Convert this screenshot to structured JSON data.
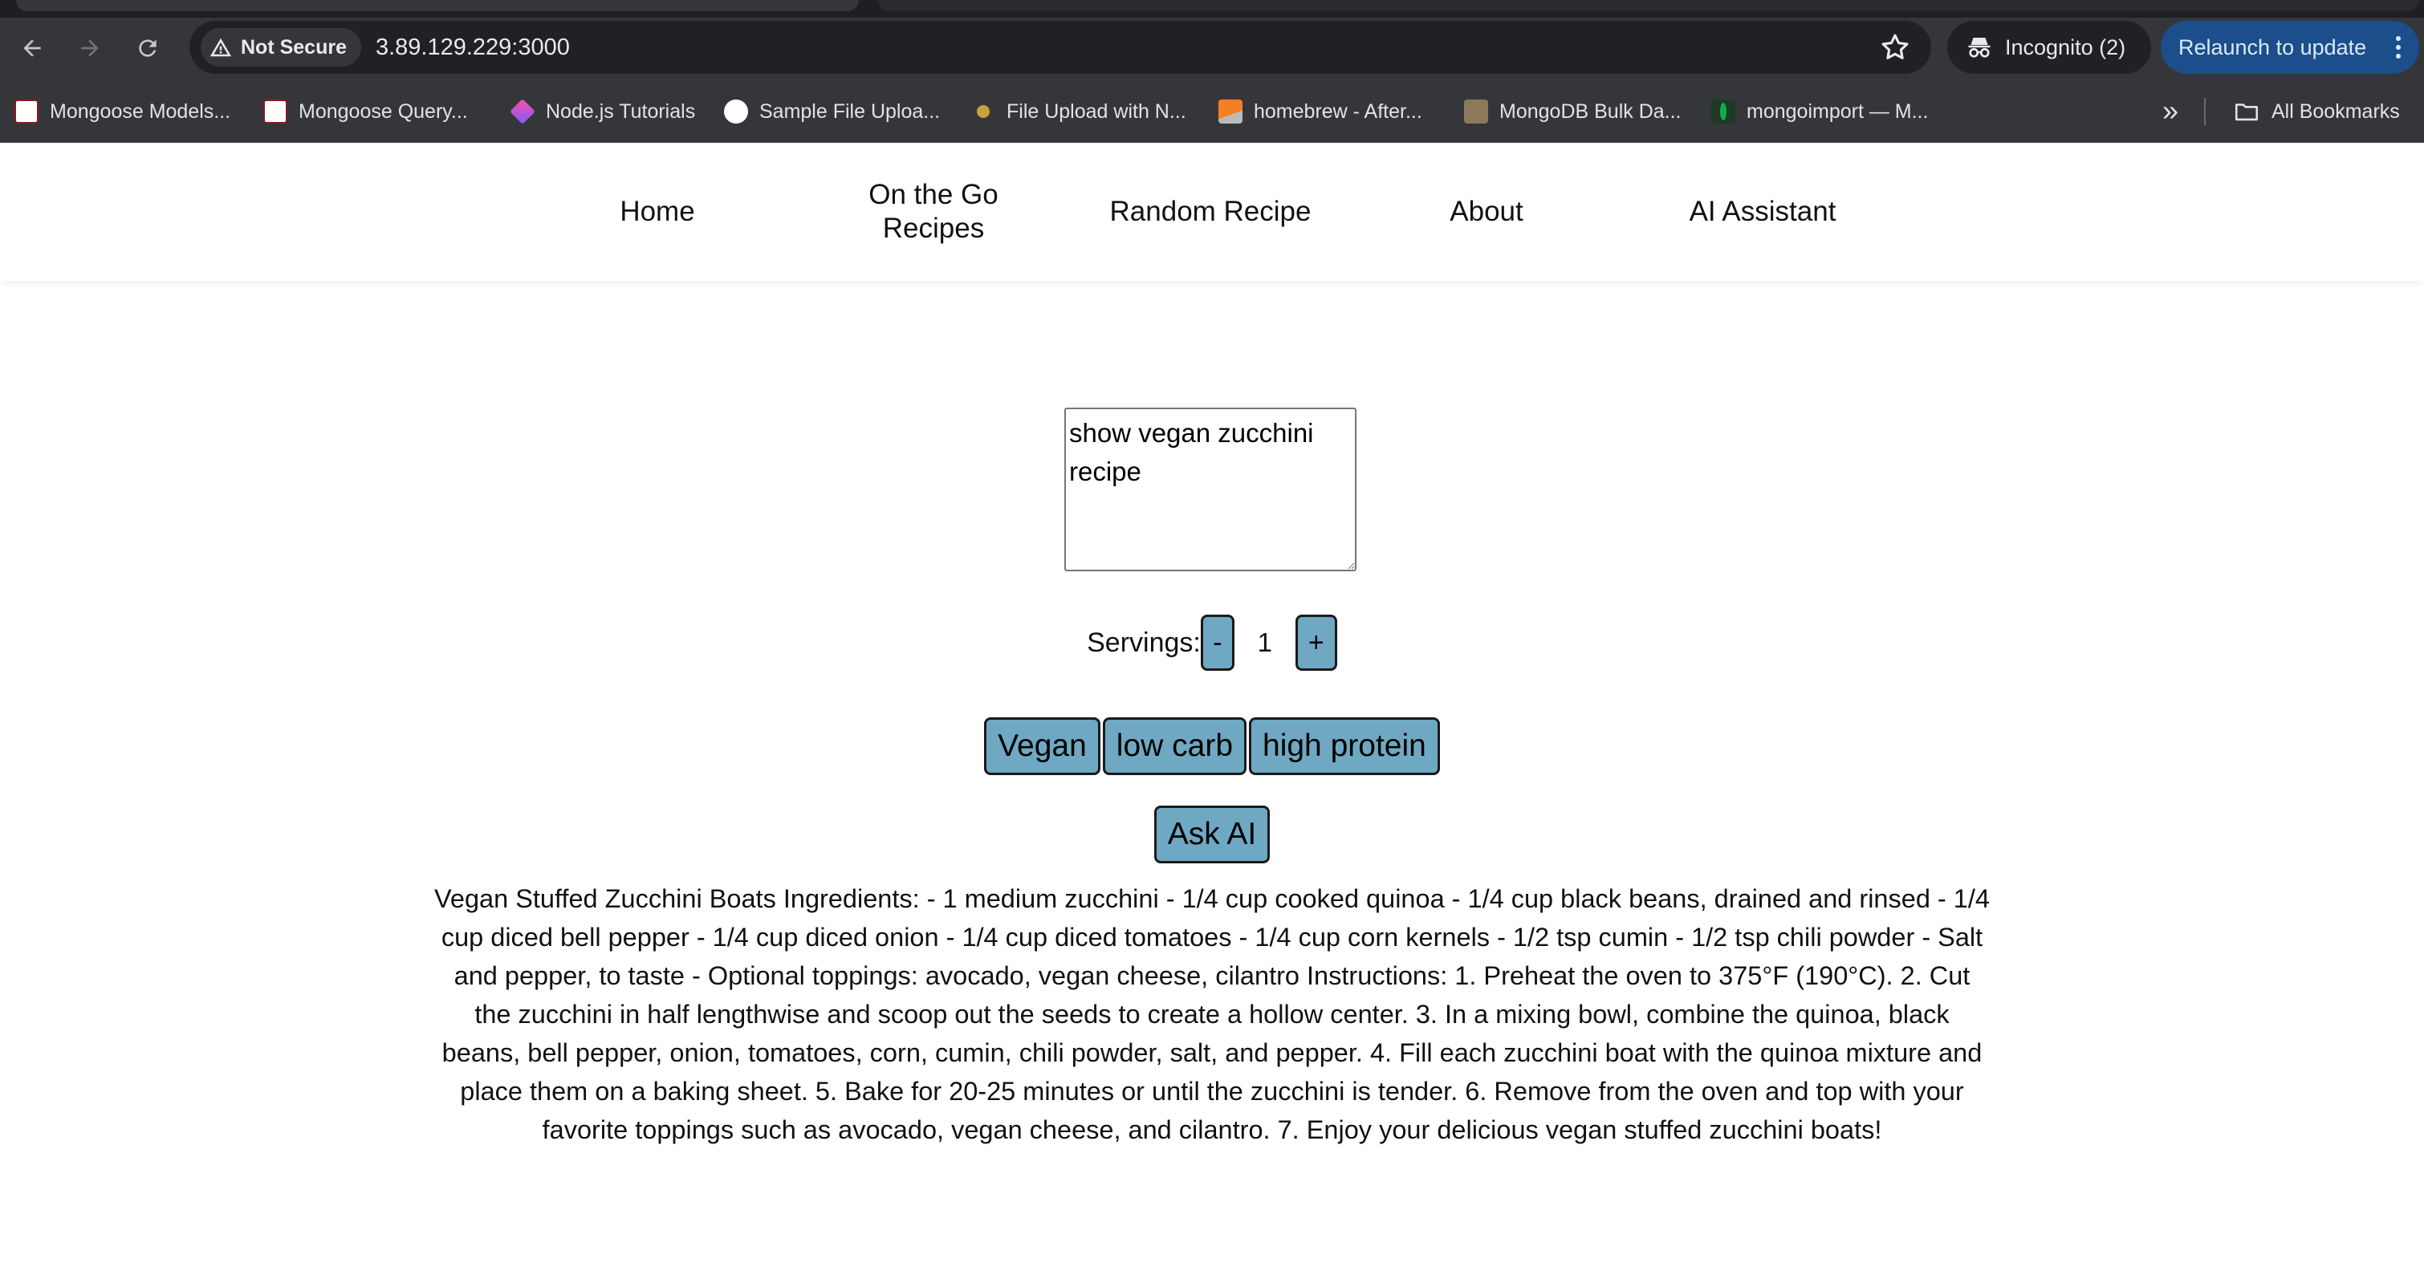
{
  "browser": {
    "security_label": "Not Secure",
    "url": "3.89.129.229:3000",
    "incognito_label": "Incognito (2)",
    "relaunch_label": "Relaunch to update",
    "bookmarks": [
      {
        "label": "Mongoose Models...",
        "icon": "mongoose-icon",
        "color": "#8b1a1a"
      },
      {
        "label": "Mongoose Query...",
        "icon": "mongoose-icon",
        "color": "#8b1a1a"
      },
      {
        "label": "Node.js Tutorials",
        "icon": "nodejs-tutorials-icon",
        "color": "#b44cf0"
      },
      {
        "label": "Sample File Uploa...",
        "icon": "github-icon",
        "color": "#ffffff"
      },
      {
        "label": "File Upload with N...",
        "icon": "sun-gear-icon",
        "color": "#c9a23a"
      },
      {
        "label": "homebrew - After...",
        "icon": "stackoverflow-icon",
        "color": "#f48024"
      },
      {
        "label": "MongoDB Bulk Da...",
        "icon": "avatar-icon",
        "color": "#8a7a5a"
      },
      {
        "label": "mongoimport — M...",
        "icon": "mongodb-leaf-icon",
        "color": "#13aa52"
      }
    ],
    "all_bookmarks_label": "All Bookmarks"
  },
  "nav": {
    "items": [
      "Home",
      "On the Go Recipes",
      "Random Recipe",
      "About",
      "AI Assistant"
    ]
  },
  "form": {
    "prompt_value": "show vegan zucchini recipe",
    "servings_label": "Servings:",
    "decrement_label": "-",
    "servings_value": "1",
    "increment_label": "+",
    "tags": [
      "Vegan",
      "low carb",
      "high protein"
    ],
    "ask_label": "Ask AI"
  },
  "answer": "Vegan Stuffed Zucchini Boats Ingredients: - 1 medium zucchini - 1/4 cup cooked quinoa - 1/4 cup black beans, drained and rinsed - 1/4 cup diced bell pepper - 1/4 cup diced onion - 1/4 cup diced tomatoes - 1/4 cup corn kernels - 1/2 tsp cumin - 1/2 tsp chili powder - Salt and pepper, to taste - Optional toppings: avocado, vegan cheese, cilantro Instructions: 1. Preheat the oven to 375°F (190°C). 2. Cut the zucchini in half lengthwise and scoop out the seeds to create a hollow center. 3. In a mixing bowl, combine the quinoa, black beans, bell pepper, onion, tomatoes, corn, cumin, chili powder, salt, and pepper. 4. Fill each zucchini boat with the quinoa mixture and place them on a baking sheet. 5. Bake for 20-25 minutes or until the zucchini is tender. 6. Remove from the oven and top with your favorite toppings such as avocado, vegan cheese, and cilantro. 7. Enjoy your delicious vegan stuffed zucchini boats!"
}
